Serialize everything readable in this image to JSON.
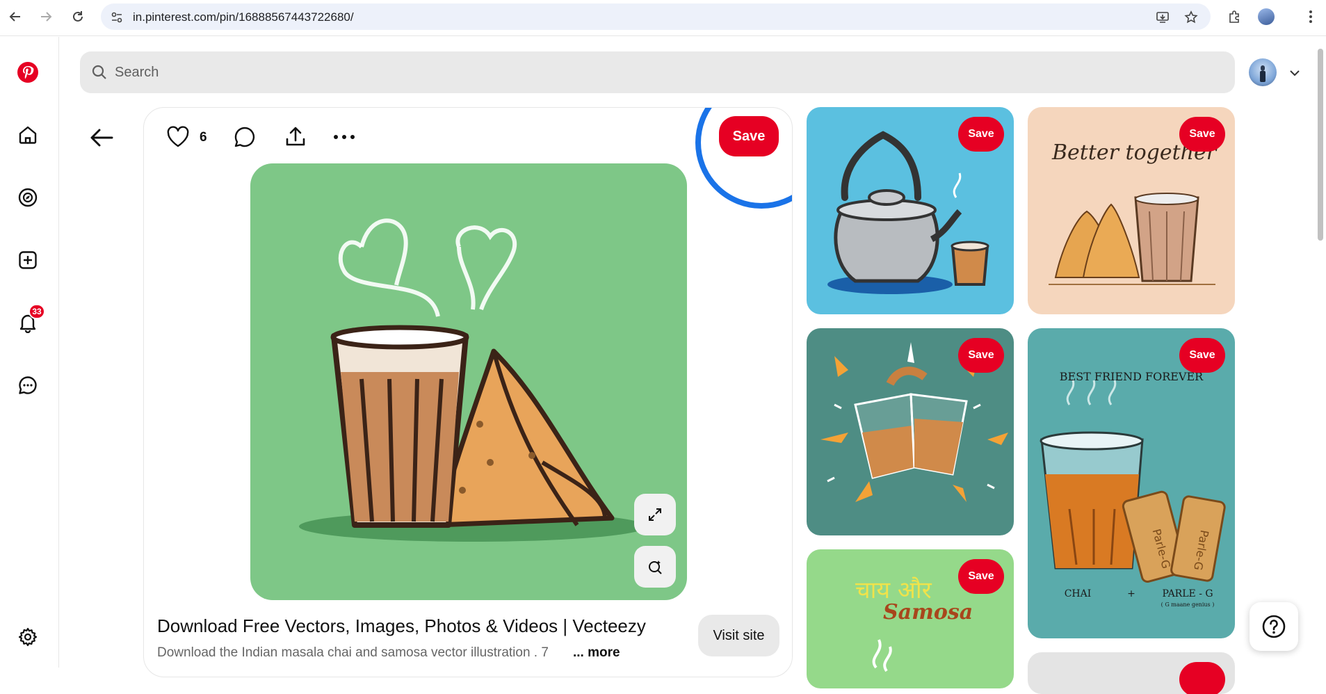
{
  "browser": {
    "url": "in.pinterest.com/pin/16888567443722680/"
  },
  "search": {
    "placeholder": "Search"
  },
  "rail": {
    "notifications_count": "33"
  },
  "pin": {
    "like_count": "6",
    "save_label": "Save",
    "title": "Download Free Vectors, Images, Photos & Videos | Vecteezy",
    "description": "Download the Indian masala chai and samosa vector illustration . 7",
    "more_label": "... more",
    "visit_label": "Visit site"
  },
  "grid": {
    "save_label": "Save",
    "pin_texts": {
      "better_together": "Better together",
      "best_friend": "BEST FRIEND FOREVER",
      "chai": "CHAI",
      "plus": "+",
      "parle": "PARLE - G",
      "parle_sub": "( G maane genius )",
      "biscuit": "Parle-G",
      "chai_hindi": "चाय और",
      "samosa": "Samosa"
    }
  },
  "colors": {
    "pinterest_red": "#e60023",
    "focus_ring": "#1a73e8"
  }
}
